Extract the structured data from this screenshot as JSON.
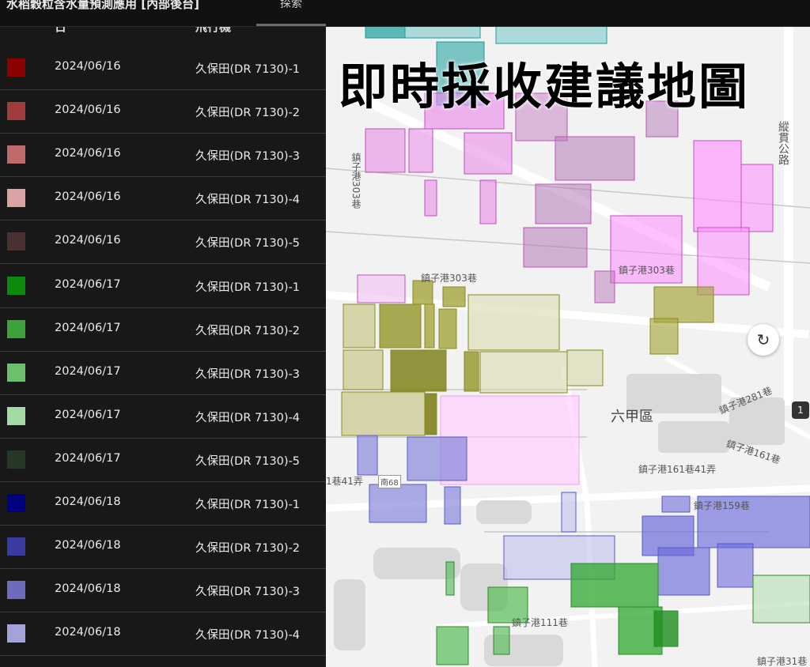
{
  "app": {
    "title": "水稻穀粒含水量預測應用 [內部後台]"
  },
  "tabs": [
    {
      "label": "探索"
    }
  ],
  "table": {
    "columns": [
      "日",
      "飛行機"
    ],
    "rows": [
      {
        "color": "#8b0000",
        "date": "2024/06/16",
        "drone": "久保田(DR 7130)-1"
      },
      {
        "color": "#a13c3c",
        "date": "2024/06/16",
        "drone": "久保田(DR 7130)-2"
      },
      {
        "color": "#bf6b6b",
        "date": "2024/06/16",
        "drone": "久保田(DR 7130)-3"
      },
      {
        "color": "#d9a3a3",
        "date": "2024/06/16",
        "drone": "久保田(DR 7130)-4"
      },
      {
        "color": "#4a3232",
        "date": "2024/06/16",
        "drone": "久保田(DR 7130)-5"
      },
      {
        "color": "#0b8a0b",
        "date": "2024/06/17",
        "drone": "久保田(DR 7130)-1"
      },
      {
        "color": "#3ca33c",
        "date": "2024/06/17",
        "drone": "久保田(DR 7130)-2"
      },
      {
        "color": "#6cbf6c",
        "date": "2024/06/17",
        "drone": "久保田(DR 7130)-3"
      },
      {
        "color": "#a3d9a3",
        "date": "2024/06/17",
        "drone": "久保田(DR 7130)-4"
      },
      {
        "color": "#263826",
        "date": "2024/06/17",
        "drone": "久保田(DR 7130)-5"
      },
      {
        "color": "#000080",
        "date": "2024/06/18",
        "drone": "久保田(DR 7130)-1"
      },
      {
        "color": "#3a3aa3",
        "date": "2024/06/18",
        "drone": "久保田(DR 7130)-2"
      },
      {
        "color": "#6c6cbf",
        "date": "2024/06/18",
        "drone": "久保田(DR 7130)-3"
      },
      {
        "color": "#a3a3d9",
        "date": "2024/06/18",
        "drone": "久保田(DR 7130)-4"
      }
    ]
  },
  "map": {
    "overlay_title": "即時採收建議地圖",
    "district": "六甲區",
    "labels": [
      "縱貫公路",
      "鎮子港303巷",
      "鎮子港303巷",
      "鎮子港303巷",
      "鎮子港281巷",
      "鎮子港161巷",
      "鎮子港161巷41弄",
      "鎮子港159巷",
      "鎮子港111巷",
      "1巷41弄",
      "南68",
      "鎮子港31巷"
    ],
    "road_badge": "1",
    "refresh_icon": "refresh-icon"
  }
}
